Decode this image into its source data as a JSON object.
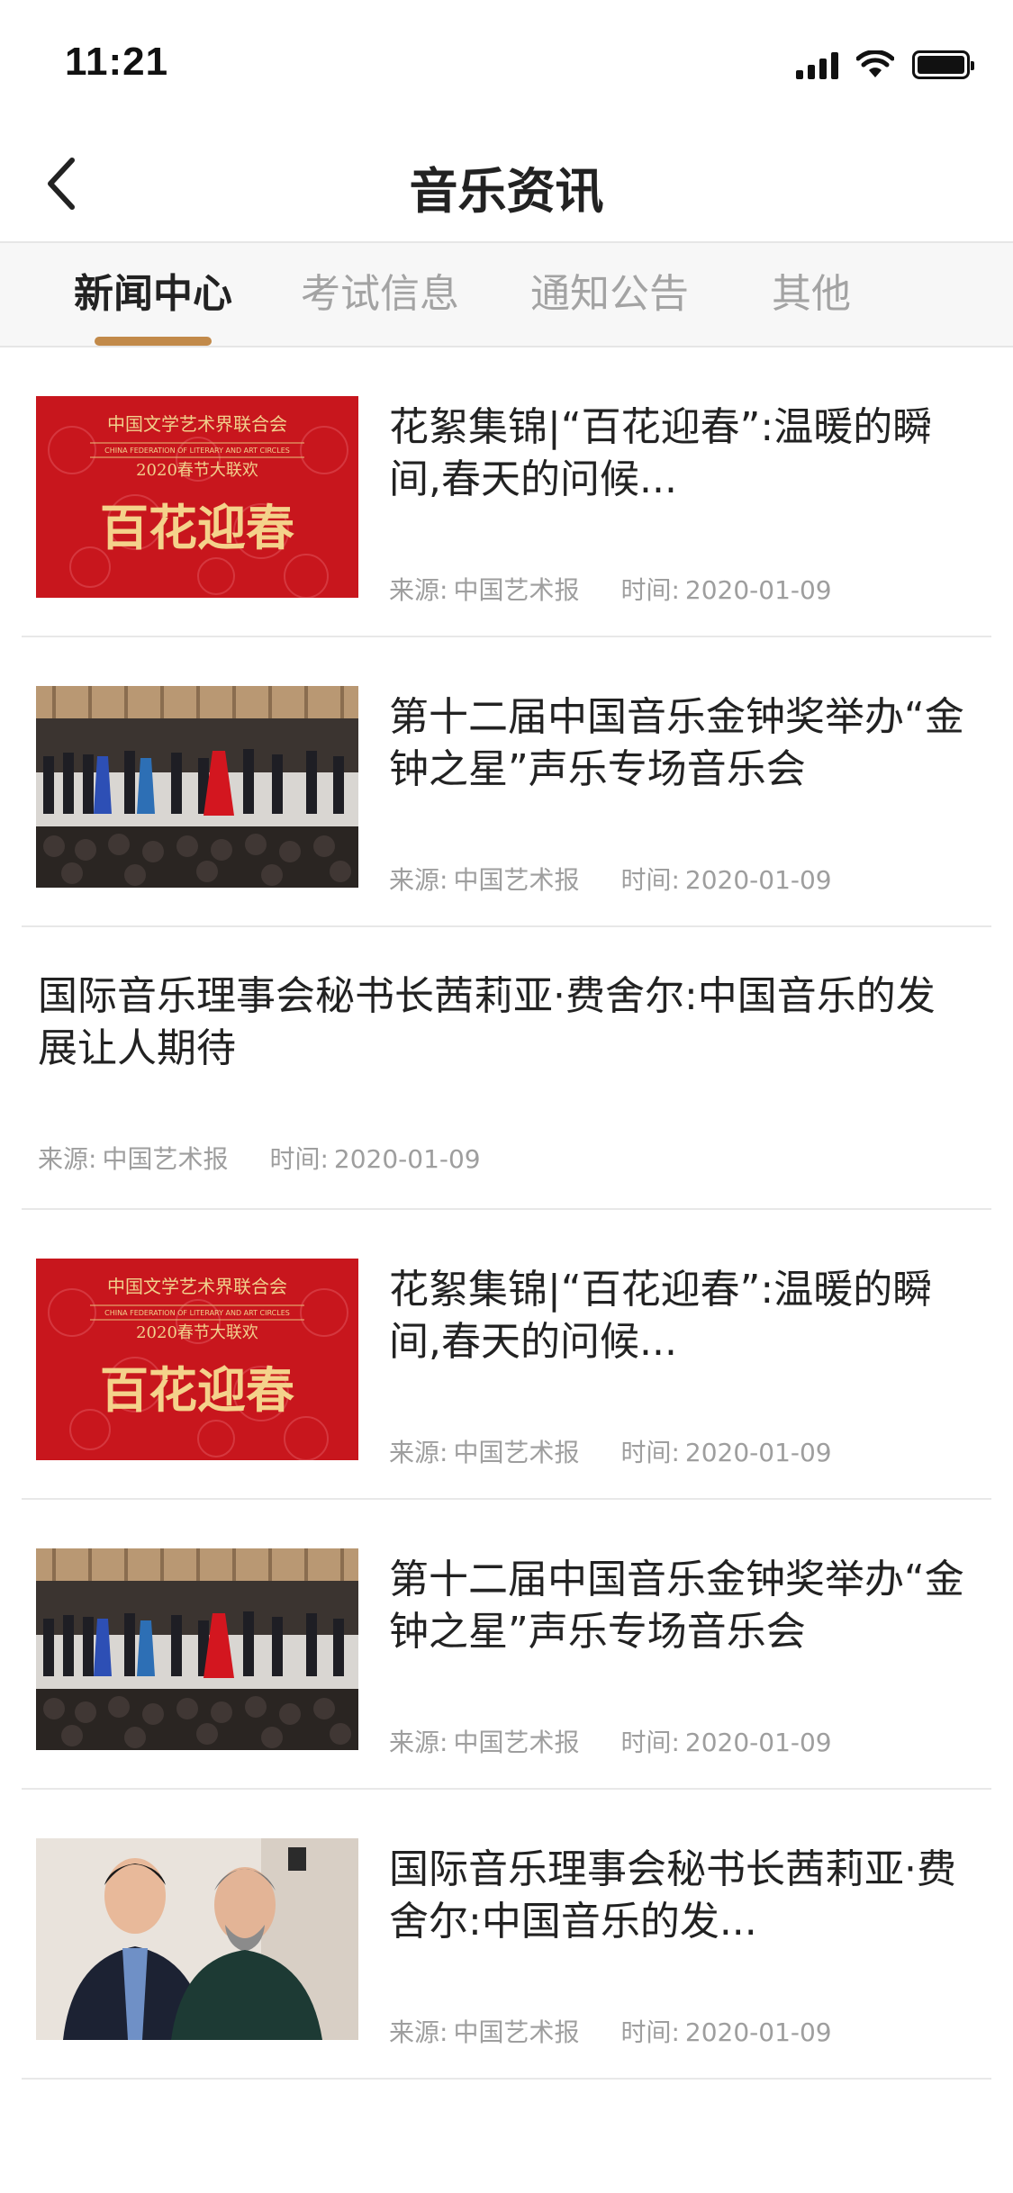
{
  "status": {
    "time": "11:21"
  },
  "nav": {
    "title": "音乐资讯"
  },
  "tabs": [
    {
      "label": "新闻中心"
    },
    {
      "label": "考试信息"
    },
    {
      "label": "通知公告"
    },
    {
      "label": "其他"
    }
  ],
  "meta_labels": {
    "source": "来源:",
    "time": "时间:"
  },
  "poster": {
    "line1": "中国文学艺术界联合会",
    "line2": "CHINA FEDERATION OF LITERARY AND ART CIRCLES",
    "line3": "2020春节大联欢",
    "calligraphy": "百花迎春"
  },
  "news": [
    {
      "title": "花絮集锦|“百花迎春”:温暖的瞬间,春天的问候...",
      "source": "中国艺术报",
      "date": "2020-01-09",
      "image": "poster"
    },
    {
      "title": "第十二届中国音乐金钟奖举办“金钟之星”声乐专场音乐会",
      "source": "中国艺术报",
      "date": "2020-01-09",
      "image": "concert"
    },
    {
      "title": "国际音乐理事会秘书长茜莉亚·费舍尔:中国音乐的发展让人期待",
      "source": "中国艺术报",
      "date": "2020-01-09",
      "image": ""
    },
    {
      "title": "花絮集锦|“百花迎春”:温暖的瞬间,春天的问候...",
      "source": "中国艺术报",
      "date": "2020-01-09",
      "image": "poster"
    },
    {
      "title": "第十二届中国音乐金钟奖举办“金钟之星”声乐专场音乐会",
      "source": "中国艺术报",
      "date": "2020-01-09",
      "image": "concert"
    },
    {
      "title": "国际音乐理事会秘书长茜莉亚·费舍尔:中国音乐的发...",
      "source": "中国艺术报",
      "date": "2020-01-09",
      "image": "portrait"
    }
  ]
}
